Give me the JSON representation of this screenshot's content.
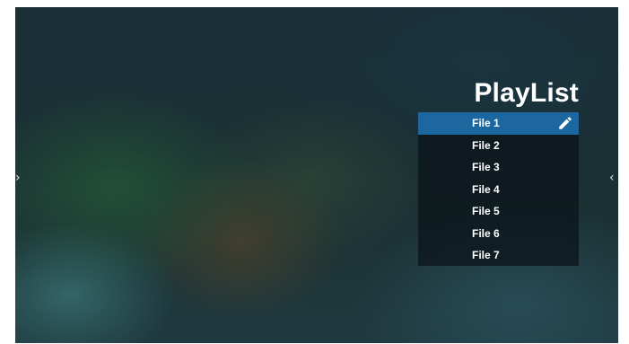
{
  "playlist": {
    "title": "PlayList",
    "selected_index": 0,
    "items": [
      {
        "label": "File 1"
      },
      {
        "label": "File 2"
      },
      {
        "label": "File 3"
      },
      {
        "label": "File 4"
      },
      {
        "label": "File 5"
      },
      {
        "label": "File 6"
      },
      {
        "label": "File 7"
      }
    ]
  },
  "navigation": {
    "left_arrow": "›",
    "right_arrow": "‹"
  },
  "icons": {
    "edit": "pencil-icon"
  },
  "colors": {
    "selected_item": "#1d67a0",
    "text": "#ffffff"
  }
}
